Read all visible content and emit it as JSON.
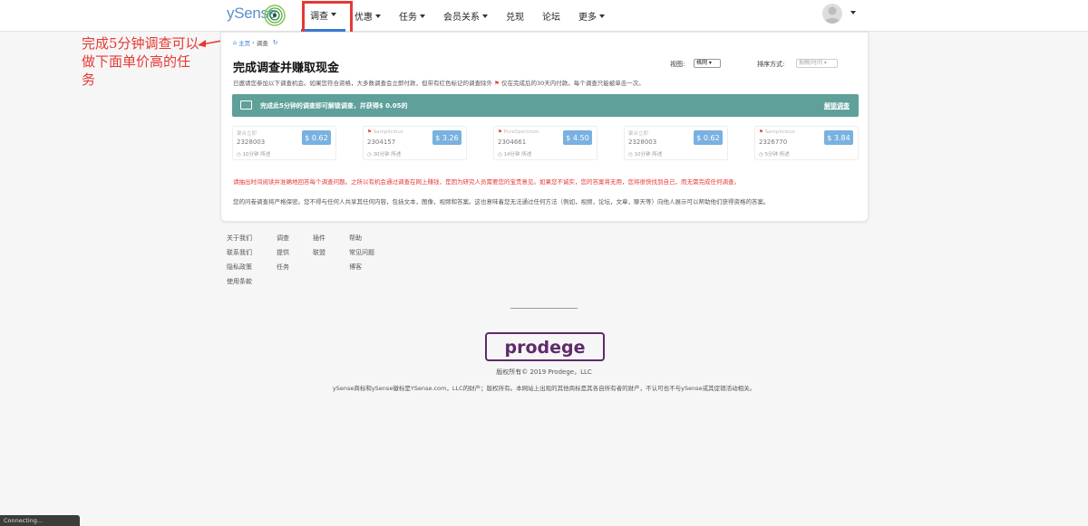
{
  "header": {
    "logo_text": "ySense",
    "nav": [
      {
        "label": "调查",
        "caret": true
      },
      {
        "label": "优惠",
        "caret": true
      },
      {
        "label": "任务",
        "caret": true
      },
      {
        "label": "会员关系",
        "caret": true
      },
      {
        "label": "兑现",
        "caret": false
      },
      {
        "label": "论坛",
        "caret": false
      },
      {
        "label": "更多",
        "caret": true
      }
    ]
  },
  "annotation": {
    "text": "完成5分钟调查可以做下面单价高的任务",
    "color": "#e53935"
  },
  "breadcrumb": {
    "home": "主页",
    "separator": "›",
    "current": "调查"
  },
  "page": {
    "title": "完成调查并赚取现金",
    "view_label": "视图:",
    "view_value": "格网 ▾",
    "sort_label": "排序方式:",
    "sort_value": "报酬/时间 ▾",
    "intro_before": "已邀请您参加以下调查机会。如果您符合资格，大多数调查会立即付款，但带有红色标记的调查除外",
    "intro_after": "仅在完成后的30天内付款。每个调查只能被单击一次。"
  },
  "banner": {
    "text": "完成此5分钟的调查即可解锁调查，并获得$ 0.05的",
    "link": "解锁调查",
    "color": "#5fa09a"
  },
  "surveys": [
    {
      "provider": "聚合立即",
      "flagged": false,
      "id": "2328003",
      "meta": "10分钟  所述",
      "price": "$ 0.62"
    },
    {
      "provider": "Samplicious",
      "flagged": true,
      "id": "2304157",
      "meta": "30分钟  所述",
      "price": "$ 3.26"
    },
    {
      "provider": "PureSpectrum",
      "flagged": true,
      "id": "2304661",
      "meta": "14分钟  所述",
      "price": "$ 4.50"
    },
    {
      "provider": "聚合立即",
      "flagged": false,
      "id": "2328003",
      "meta": "10分钟  所述",
      "price": "$ 0.62"
    },
    {
      "provider": "Samplicious",
      "flagged": true,
      "id": "2326770",
      "meta": "5分钟  所述",
      "price": "$ 3.84"
    }
  ],
  "notice": "请抽出时间阅读并准确地回答每个调查问题。之所以有机会通过调查在网上赚钱，是因为研究人员需要您的宝贵意见。如果您不诚实，您的答案将无用，您将很快找到自己，而无需完成任何调查。",
  "policy": "您的问卷调查将严格保密。您不得与任何人共享其任何内容，包括文本，图像，视频和答案。这也意味着您无法通过任何方法（例如，视频，论坛，文章，聊天等）向他人展示可以帮助他们获得资格的答案。",
  "footer": {
    "col1": [
      "关于我们",
      "联系我们",
      "隐私政策",
      "使用条款"
    ],
    "col2": [
      "调查",
      "提供",
      "任务"
    ],
    "col3": [
      "插件",
      "联盟"
    ],
    "col4": [
      "帮助",
      "常见问题",
      "博客"
    ],
    "brand": "prodege",
    "copyright": "版权所有© 2019 Prodege，LLC",
    "trademark": "ySense商标和ySense徽标是YSense.com，LLC的财产；版权所有。本网站上出现的其他商标是其各自所有者的财产，不认可也不与ySense或其促销活动相关。"
  },
  "status_bar": "Connecting..."
}
